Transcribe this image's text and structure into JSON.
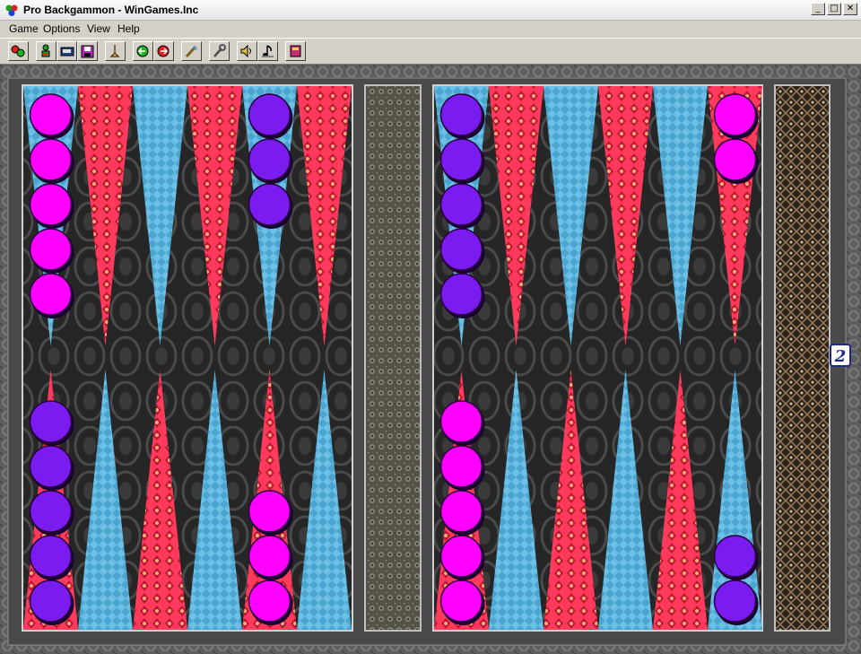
{
  "window": {
    "title": "Pro Backgammon - WinGames.Inc"
  },
  "window_buttons": [
    "_",
    "□",
    "✕"
  ],
  "menu": [
    "Game",
    "Options",
    "View",
    "Help"
  ],
  "toolbar": [
    {
      "icon": "new-game-icon"
    },
    {
      "icon": "players-icon"
    },
    {
      "icon": "open-game-icon"
    },
    {
      "icon": "save-game-icon"
    },
    {
      "icon": "hint-icon"
    },
    {
      "icon": "undo-icon"
    },
    {
      "icon": "redo-icon"
    },
    {
      "icon": "board-design-icon"
    },
    {
      "icon": "settings-tool-icon"
    },
    {
      "icon": "sound-icon"
    },
    {
      "icon": "music-icon"
    },
    {
      "icon": "help-book-icon"
    }
  ],
  "colors": {
    "player_a": "#ff00ff",
    "player_b": "#7a1cf0",
    "point_red": "#ff3a5c",
    "point_blue": "#4aa6d0",
    "board_bg": "#2b2b2b",
    "frame": "#6b6b6b"
  },
  "board": {
    "left_half": {
      "top": [
        {
          "player": "a",
          "count": 5
        },
        {
          "player": null,
          "count": 0
        },
        {
          "player": null,
          "count": 0
        },
        {
          "player": null,
          "count": 0
        },
        {
          "player": "b",
          "count": 3
        },
        {
          "player": null,
          "count": 0
        }
      ],
      "bottom": [
        {
          "player": "b",
          "count": 5
        },
        {
          "player": null,
          "count": 0
        },
        {
          "player": null,
          "count": 0
        },
        {
          "player": null,
          "count": 0
        },
        {
          "player": "a",
          "count": 3
        },
        {
          "player": null,
          "count": 0
        }
      ]
    },
    "right_half": {
      "top": [
        {
          "player": "b",
          "count": 5
        },
        {
          "player": null,
          "count": 0
        },
        {
          "player": null,
          "count": 0
        },
        {
          "player": null,
          "count": 0
        },
        {
          "player": null,
          "count": 0
        },
        {
          "player": "a",
          "count": 2
        }
      ],
      "bottom": [
        {
          "player": "a",
          "count": 5
        },
        {
          "player": null,
          "count": 0
        },
        {
          "player": null,
          "count": 0
        },
        {
          "player": null,
          "count": 0
        },
        {
          "player": null,
          "count": 0
        },
        {
          "player": "b",
          "count": 2
        }
      ]
    }
  },
  "doubling_cube": "2"
}
